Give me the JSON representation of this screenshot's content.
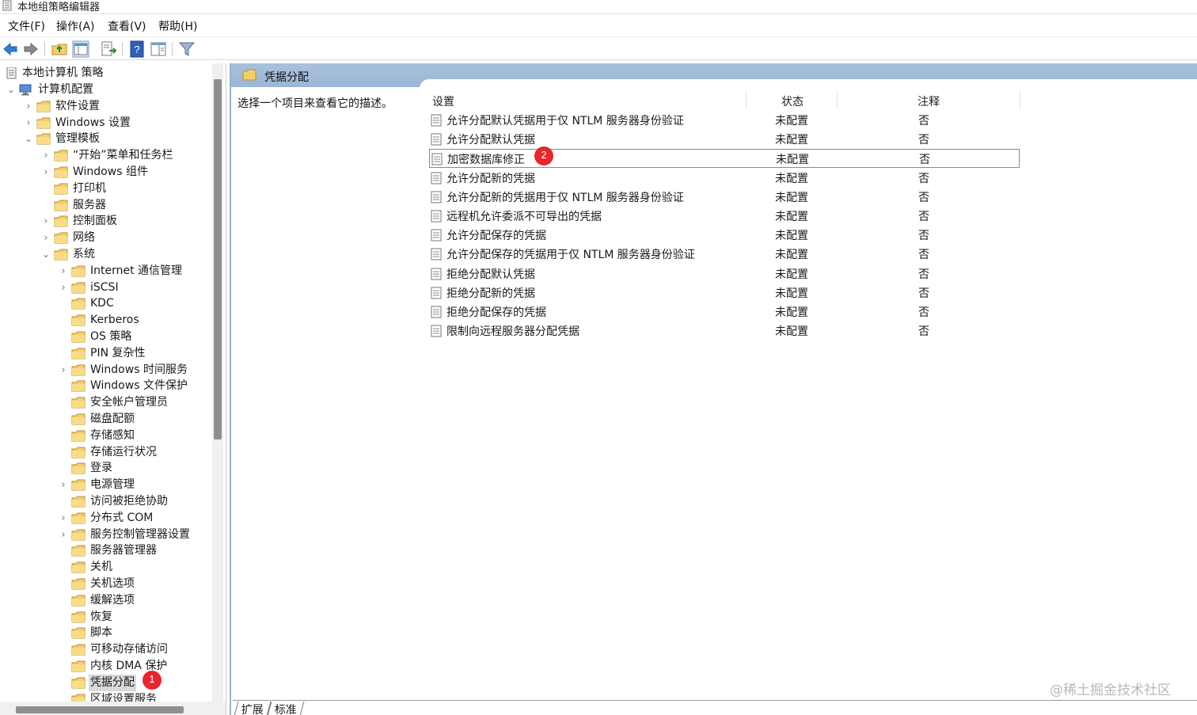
{
  "window": {
    "title": "本地组策略编辑器"
  },
  "menu": [
    "文件(F)",
    "操作(A)",
    "查看(V)",
    "帮助(H)"
  ],
  "toolbar": {
    "buttons": [
      "back-arrow-icon",
      "forward-arrow-icon",
      "up-folder-icon",
      "show-hide-tree-icon",
      "export-list-icon",
      "help-icon",
      "view-pane-icon",
      "filter-icon"
    ]
  },
  "tree": {
    "root": "本地计算机 策略",
    "items": [
      "计算机配置",
      "软件设置",
      "Windows 设置",
      "管理模板",
      "“开始”菜单和任务栏",
      "Windows 组件",
      "打印机",
      "服务器",
      "控制面板",
      "网络",
      "系统",
      "Internet 通信管理",
      "iSCSI",
      "KDC",
      "Kerberos",
      "OS 策略",
      "PIN 复杂性",
      "Windows 时间服务",
      "Windows 文件保护",
      "安全帐户管理员",
      "磁盘配额",
      "存储感知",
      "存储运行状况",
      "登录",
      "电源管理",
      "访问被拒绝协助",
      "分布式 COM",
      "服务控制管理器设置",
      "服务器管理器",
      "关机",
      "关机选项",
      "缓解选项",
      "恢复",
      "脚本",
      "可移动存储访问",
      "内核 DMA 保护",
      "凭据分配",
      "区域设置服务"
    ],
    "selected": "凭据分配"
  },
  "right": {
    "header_title": "凭据分配",
    "description": "选择一个项目来查看它的描述。",
    "columns": [
      "设置",
      "状态",
      "注释"
    ],
    "rows": [
      {
        "name": "允许分配默认凭据用于仅 NTLM 服务器身份验证",
        "state": "未配置",
        "note": "否"
      },
      {
        "name": "允许分配默认凭据",
        "state": "未配置",
        "note": "否"
      },
      {
        "name": "加密数据库修正",
        "state": "未配置",
        "note": "否"
      },
      {
        "name": "允许分配新的凭据",
        "state": "未配置",
        "note": "否"
      },
      {
        "name": "允许分配新的凭据用于仅 NTLM 服务器身份验证",
        "state": "未配置",
        "note": "否"
      },
      {
        "name": "远程机允许委派不可导出的凭据",
        "state": "未配置",
        "note": "否"
      },
      {
        "name": "允许分配保存的凭据",
        "state": "未配置",
        "note": "否"
      },
      {
        "name": "允许分配保存的凭据用于仅 NTLM 服务器身份验证",
        "state": "未配置",
        "note": "否"
      },
      {
        "name": "拒绝分配默认凭据",
        "state": "未配置",
        "note": "否"
      },
      {
        "name": "拒绝分配新的凭据",
        "state": "未配置",
        "note": "否"
      },
      {
        "name": "拒绝分配保存的凭据",
        "state": "未配置",
        "note": "否"
      },
      {
        "name": "限制向远程服务器分配凭据",
        "state": "未配置",
        "note": "否"
      }
    ],
    "focused_row": "加密数据库修正",
    "tabs": [
      "扩展",
      "标准"
    ]
  },
  "annotations": {
    "badge1": "1",
    "badge2": "2"
  },
  "watermark": "@稀土掘金技术社区",
  "colors": {
    "header_blue": "#a9c1dd",
    "badge_red": "#e8262f",
    "folder_yellow": "#f3cf6b"
  }
}
